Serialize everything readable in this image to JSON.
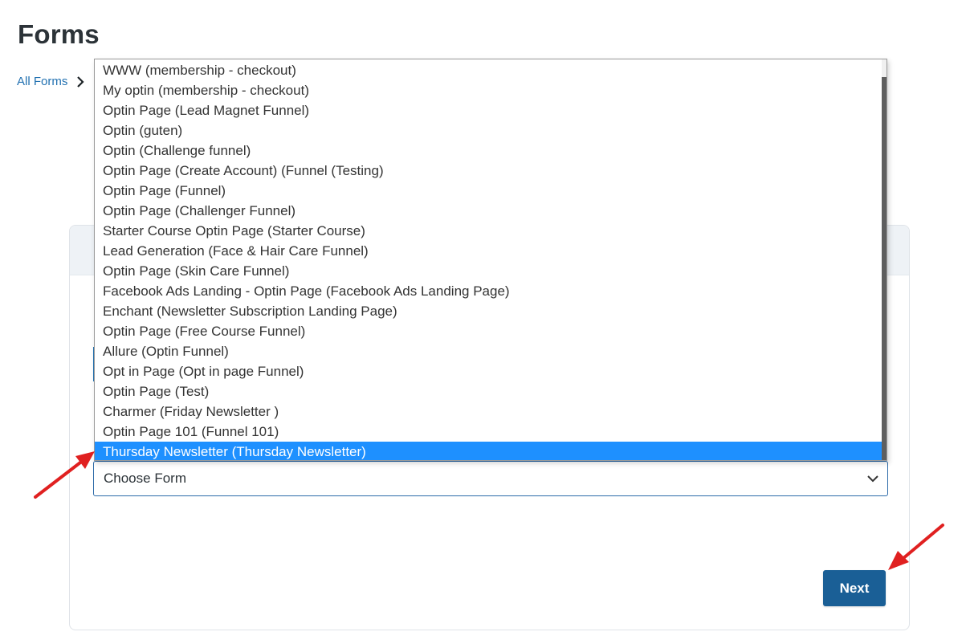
{
  "page": {
    "title": "Forms"
  },
  "breadcrumb": {
    "root": "All Forms",
    "separator_icon": "chevron-right-icon"
  },
  "form_select": {
    "value": "Choose Form",
    "icon": "chevron-down-icon",
    "options": [
      "WWW (membership - checkout)",
      "My optin (membership - checkout)",
      "Optin Page (Lead Magnet Funnel)",
      "Optin (guten)",
      "Optin (Challenge funnel)",
      "Optin Page (Create Account) (Funnel (Testing)",
      "Optin Page (Funnel)",
      "Optin Page (Challenger Funnel)",
      "Starter Course Optin Page (Starter Course)",
      "Lead Generation (Face & Hair Care Funnel)",
      "Optin Page (Skin Care Funnel)",
      "Facebook Ads Landing - Optin Page (Facebook Ads Landing Page)",
      "Enchant (Newsletter Subscription Landing Page)",
      "Optin Page (Free Course Funnel)",
      "Allure (Optin Funnel)",
      "Opt in Page (Opt in page Funnel)",
      "Optin Page (Test)",
      "Charmer (Friday Newsletter )",
      "Optin Page 101 (Funnel 101)",
      "Thursday Newsletter (Thursday Newsletter)"
    ],
    "highlighted_index": 19
  },
  "actions": {
    "next_label": "Next"
  },
  "colors": {
    "primary": "#1a5f96",
    "highlight": "#1e90ff",
    "link": "#2271b1",
    "annotation_arrow": "#e02020"
  }
}
